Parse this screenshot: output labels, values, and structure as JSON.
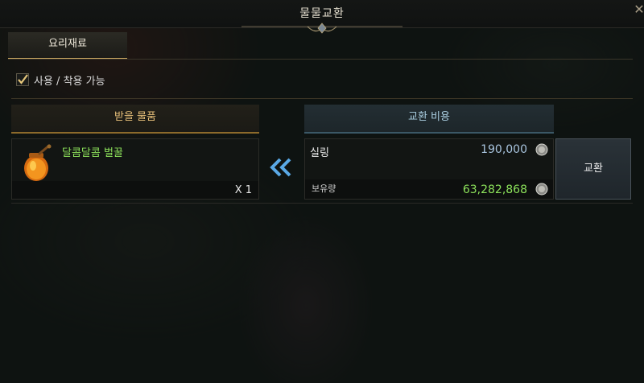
{
  "window": {
    "title": "물물교환",
    "close_symbol": "✕"
  },
  "tabs": [
    {
      "label": "요리재료",
      "active": true
    }
  ],
  "filter": {
    "checkbox_label": "사용 / 착용 가능",
    "checked": true
  },
  "receive": {
    "header": "받을 물품",
    "item": {
      "name": "달콤달콤 벌꿀",
      "quantity": "X 1",
      "icon": "honey-jar-icon"
    }
  },
  "arrow_icon": "double-chevron-left-icon",
  "cost": {
    "header": "교환 비용",
    "currency_label": "실링",
    "price": "190,000",
    "owned_label": "보유량",
    "owned_amount": "63,282,868",
    "coin_icon": "silver-coin-icon"
  },
  "exchange_button": {
    "label": "교환"
  },
  "colors": {
    "accent_gold": "#c9a862",
    "item_green": "#8de35b",
    "cost_blue": "#a9cde0"
  }
}
